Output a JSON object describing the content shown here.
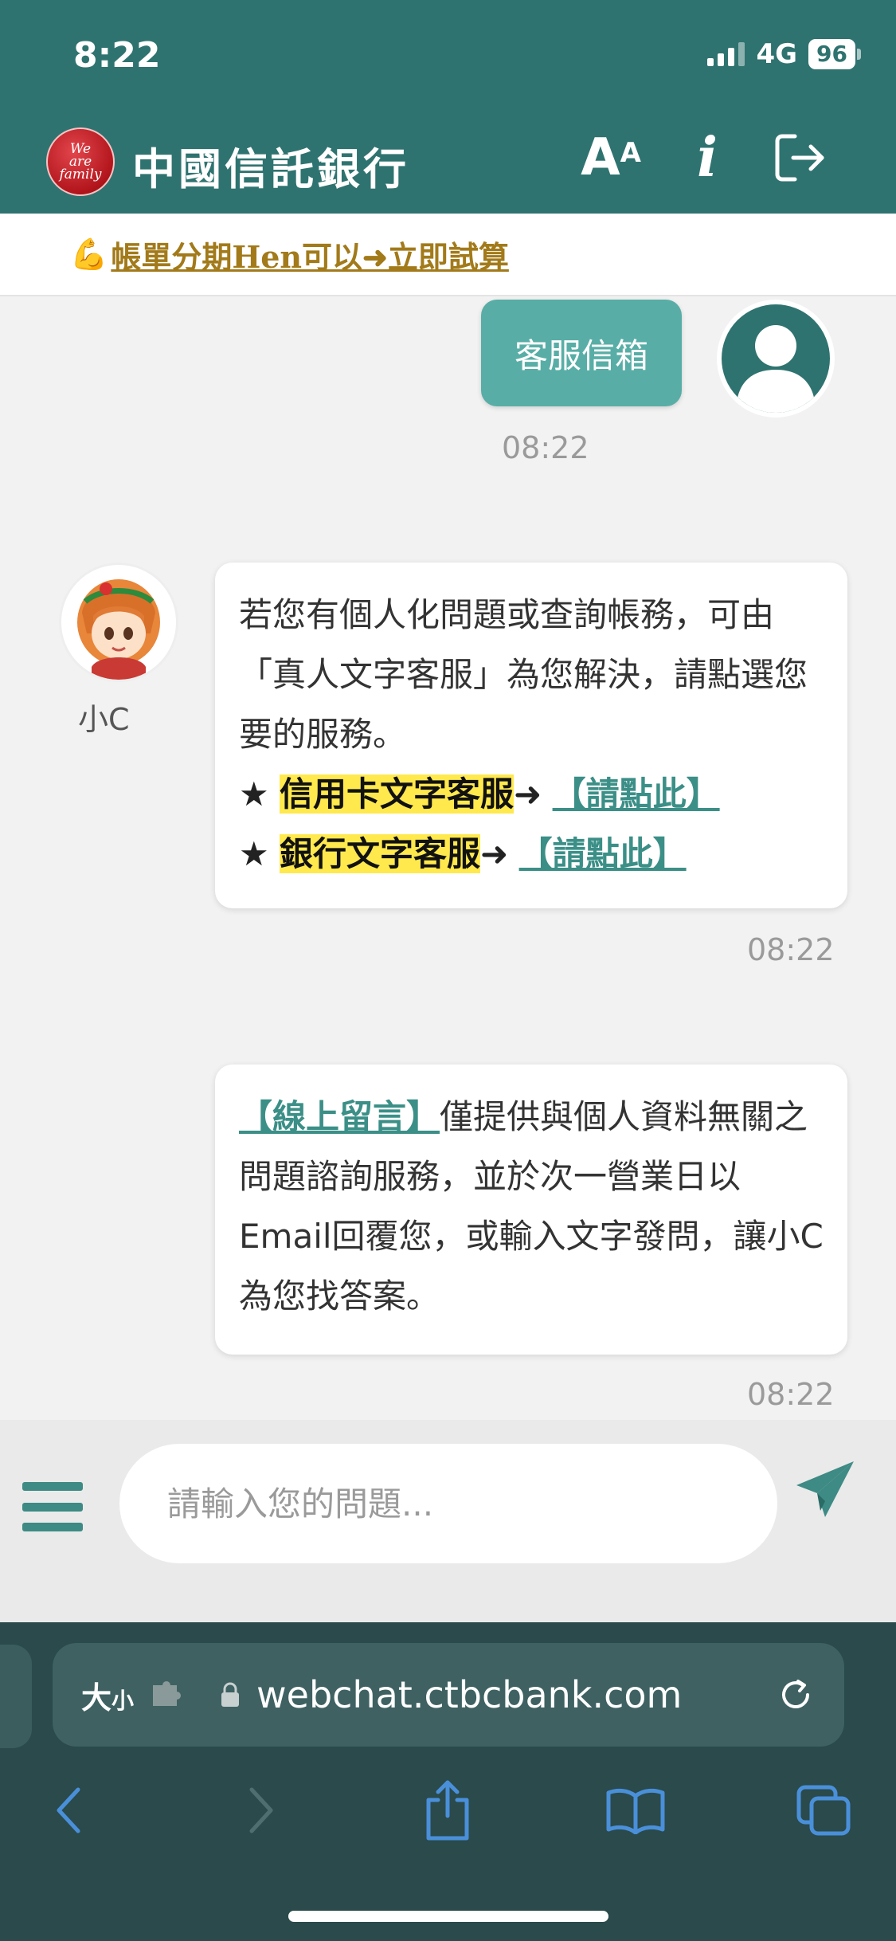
{
  "status_bar": {
    "time": "8:22",
    "network": "4G",
    "battery": "96"
  },
  "header": {
    "logo_text": "We are family",
    "title": "中國信託銀行",
    "font_size_icon": "font-size-icon",
    "info_icon": "info-icon",
    "logout_icon": "logout-icon"
  },
  "promo": {
    "icon": "flexed-biceps-emoji",
    "emoji": "💪",
    "text": "帳單分期Hen可以➜立即試算"
  },
  "chat": {
    "user_message": "客服信箱",
    "user_time": "08:22",
    "bot_name": "小C",
    "bot_message_1": {
      "line_1": "若您有個人化問題或查詢帳務，可由「真人文字客服」為您解決，請點選您要的服務。",
      "option_1": {
        "star": "★",
        "label": "信用卡文字客服",
        "arrow": "➜",
        "link": "【請點此】"
      },
      "option_2": {
        "star": "★",
        "label": "銀行文字客服",
        "arrow": "➜",
        "link": "【請點此】"
      },
      "time": "08:22"
    },
    "bot_message_2": {
      "link": "【線上留言】",
      "text": "僅提供與個人資料無關之問題諮詢服務，並於次一營業日以Email回覆您，或輸入文字發問，讓小C為您找答案。",
      "time": "08:22"
    }
  },
  "input_bar": {
    "placeholder": "請輸入您的問題..."
  },
  "browser": {
    "text_size_label": "大",
    "text_size_small": "小",
    "url": "webchat.ctbcbank.com"
  },
  "colors": {
    "brand_teal": "#2f7370",
    "user_bubble": "#58aea6",
    "highlight": "#ffe94d",
    "link": "#3b8f87",
    "promo": "#a27a1a"
  }
}
